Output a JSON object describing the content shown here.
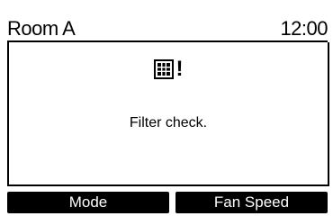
{
  "header": {
    "room_name": "Room A",
    "time": "12:00"
  },
  "message": {
    "icon": "filter-grid-icon",
    "alert_mark": "!",
    "text": "Filter check."
  },
  "softkeys": {
    "left_label": "Mode",
    "right_label": "Fan Speed"
  },
  "colors": {
    "foreground": "#000000",
    "background": "#ffffff"
  }
}
